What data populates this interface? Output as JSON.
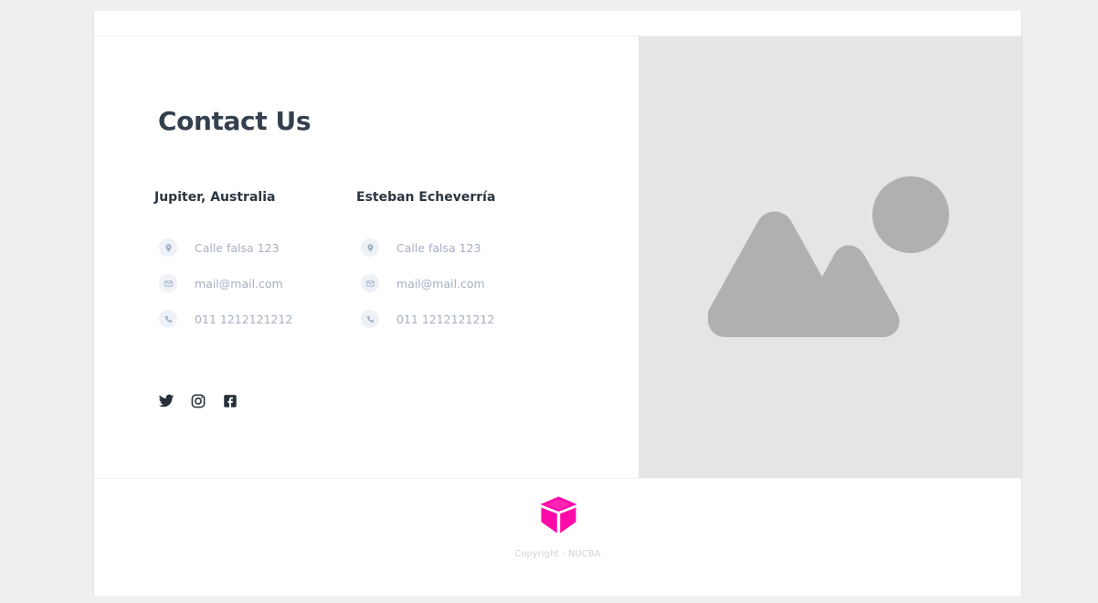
{
  "contact": {
    "title": "Contact Us",
    "locations": [
      {
        "name": "Jupiter, Australia",
        "address": "Calle falsa 123",
        "email": "mail@mail.com",
        "phone": "011 1212121212"
      },
      {
        "name": "Esteban Echeverría",
        "address": "Calle falsa 123",
        "email": "mail@mail.com",
        "phone": "011 1212121212"
      }
    ],
    "icons": {
      "address": "location-pin-icon",
      "email": "mail-icon",
      "phone": "phone-icon"
    },
    "social": [
      {
        "name": "twitter-icon"
      },
      {
        "name": "instagram-icon"
      },
      {
        "name": "facebook-icon"
      }
    ]
  },
  "media": {
    "placeholder_icon": "image-placeholder-icon"
  },
  "footer": {
    "logo_icon": "nucba-logo-icon",
    "copyright": "Copyright - NUCBA"
  },
  "colors": {
    "page_background": "#efefef",
    "panel_background": "#ffffff",
    "image_background": "#e5e5e5",
    "image_shape": "#b0b0b0",
    "heading": "#34404d",
    "muted_text": "#a4b0c2",
    "brand_accent": "#ff0aa8",
    "copyright_text": "#d2d2d2"
  }
}
